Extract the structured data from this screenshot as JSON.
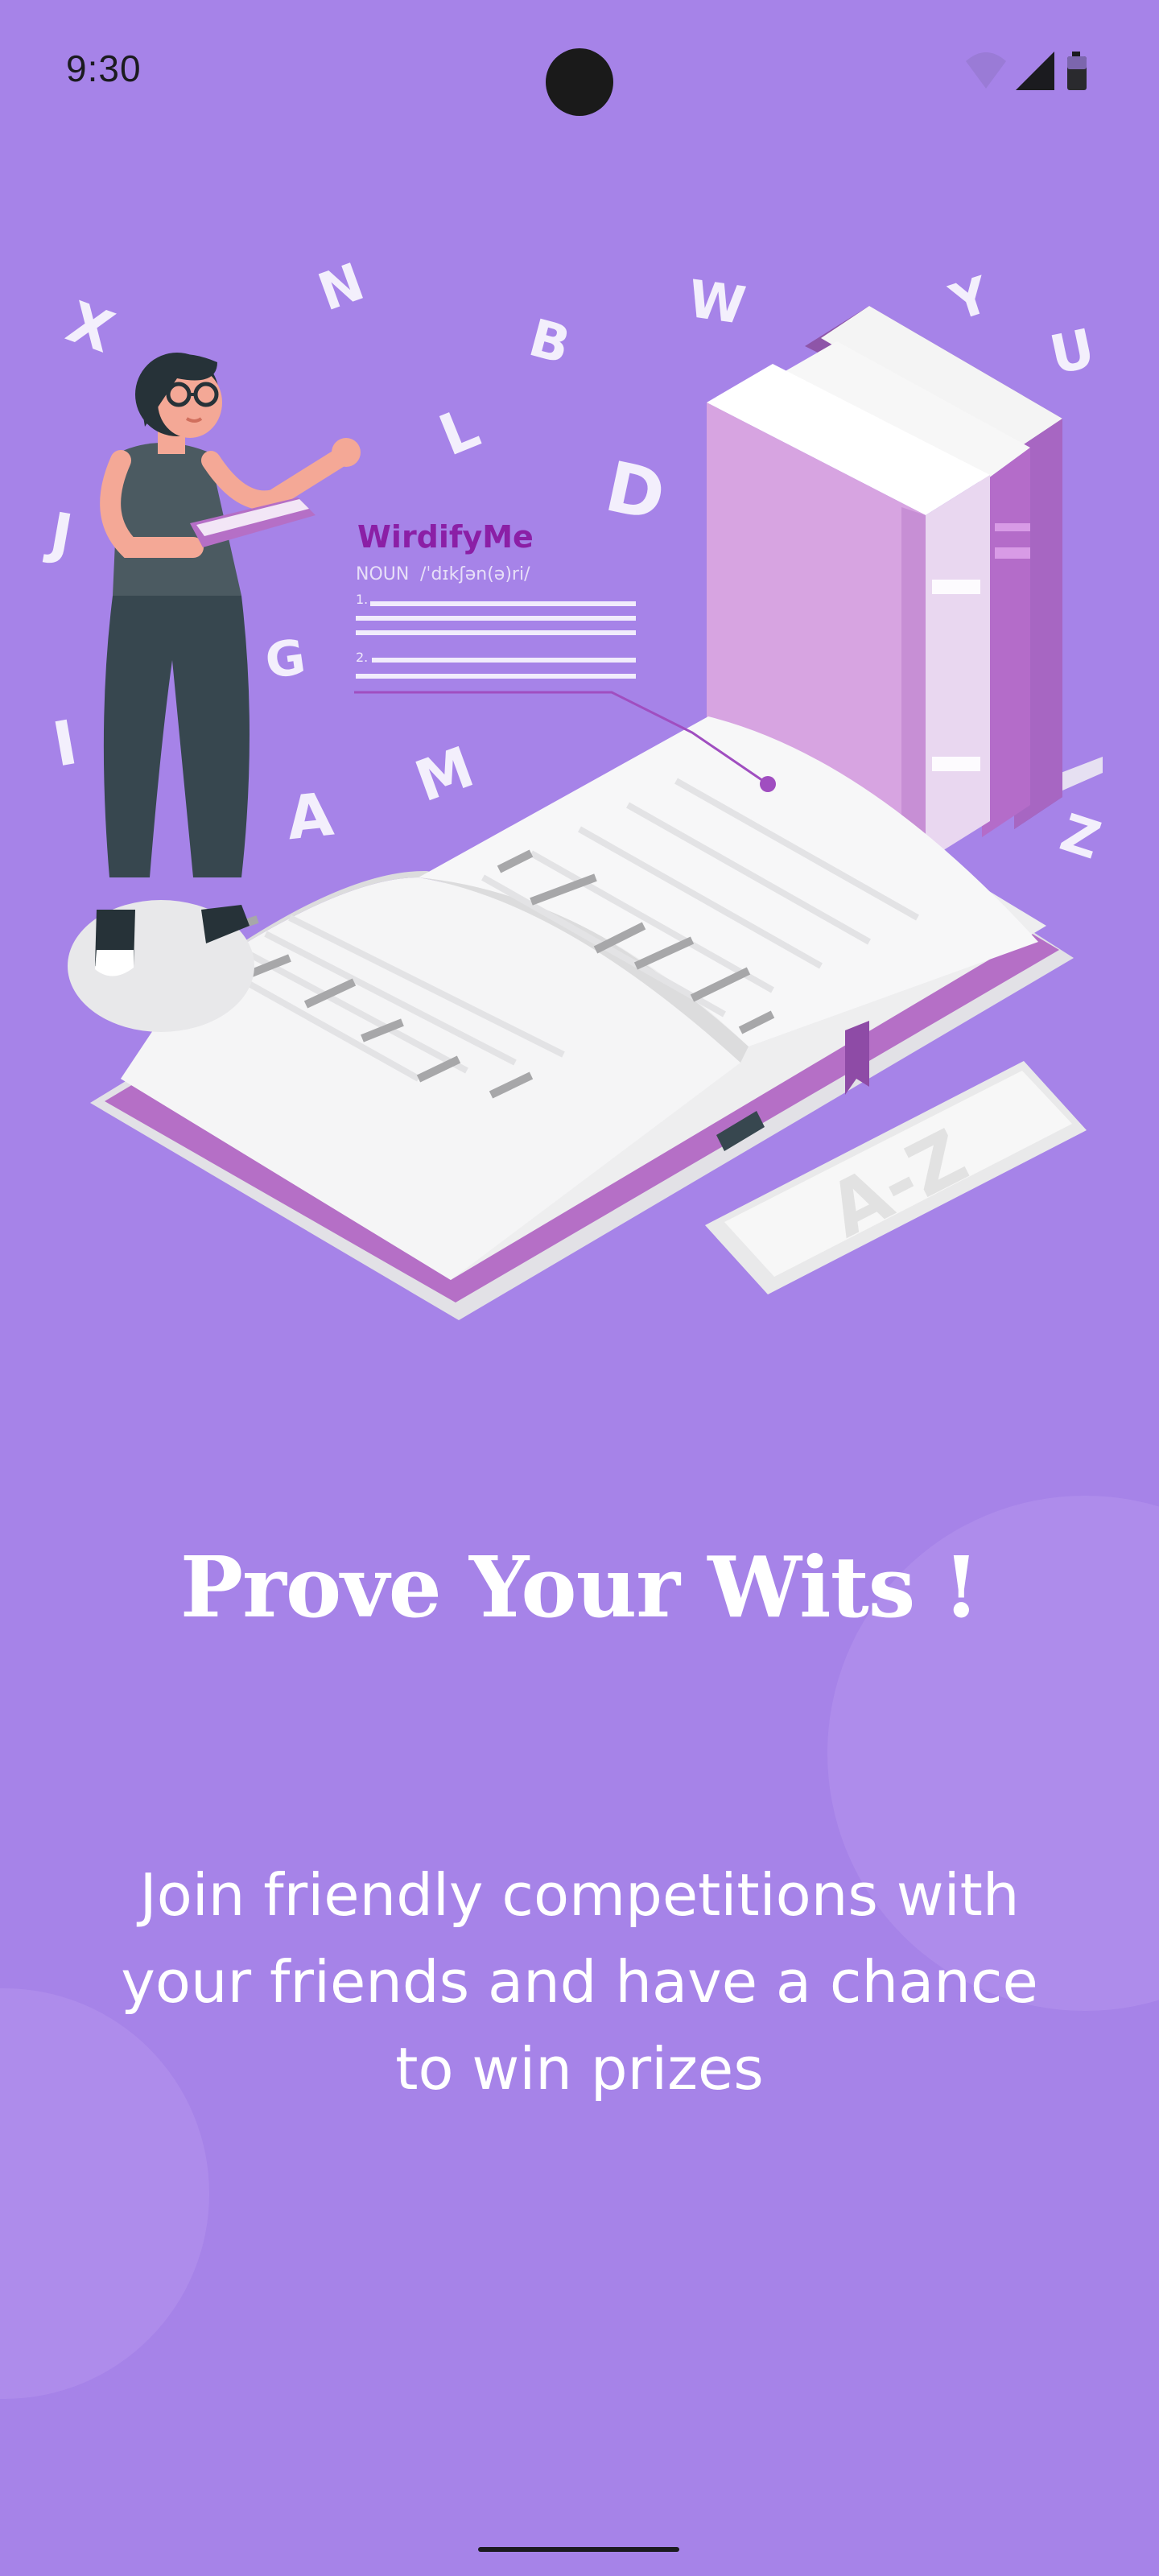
{
  "status_bar": {
    "time": "9:30",
    "icons": [
      "wifi-icon",
      "cellular-signal-icon",
      "battery-icon"
    ]
  },
  "illustration": {
    "dictionary_title": "WirdifyMe",
    "part_of_speech": "NOUN",
    "pronunciation": "/ˈdɪkʃən(ə)ri/",
    "definition_numbers": [
      "1.",
      "2."
    ],
    "tile_text": "A-Z",
    "floating_letters": [
      "X",
      "N",
      "B",
      "W",
      "Y",
      "U",
      "J",
      "L",
      "D",
      "G",
      "I",
      "A",
      "M",
      "Z"
    ]
  },
  "onboarding": {
    "title": "Prove Your Wits !",
    "description": "Join friendly competitions with your friends and have a chance to win prizes"
  },
  "colors": {
    "background": "#a683e8",
    "accent_purple": "#8b1fa6",
    "text": "#ffffff"
  }
}
